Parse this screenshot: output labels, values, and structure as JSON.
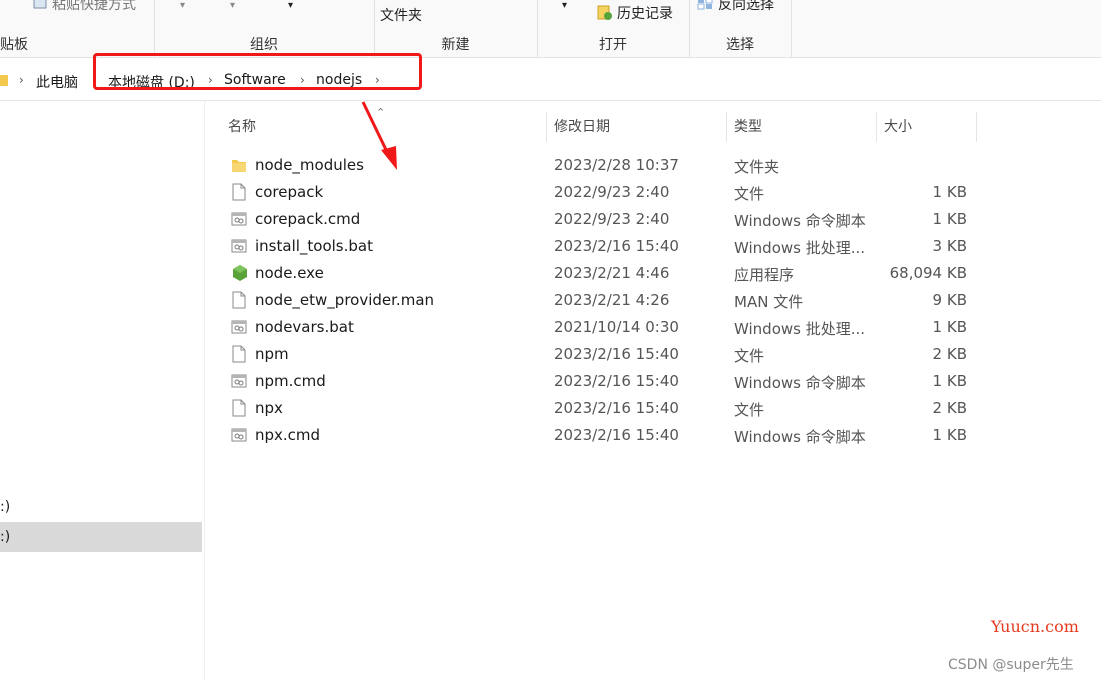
{
  "ribbon": {
    "clipboard_label": "贴板",
    "paste_shortcut": "粘贴快捷方式",
    "organize_label": "组织",
    "new_folder": "文件夹",
    "new_label": "新建",
    "history": "历史记录",
    "open_label": "打开",
    "invert_selection": "反向选择",
    "select_label": "选择"
  },
  "address": {
    "crumbs": [
      "此电脑",
      "本地磁盘 (D:)",
      "Software",
      "nodejs"
    ]
  },
  "nav": {
    "items": [
      {
        "label": ":)",
        "selected": false
      },
      {
        "label": ":)",
        "selected": true
      }
    ]
  },
  "columns": {
    "name": "名称",
    "date": "修改日期",
    "type": "类型",
    "size": "大小"
  },
  "files": [
    {
      "name": "node_modules",
      "date": "2023/2/28 10:37",
      "type": "文件夹",
      "size": "",
      "icon": "folder-icon"
    },
    {
      "name": "corepack",
      "date": "2022/9/23 2:40",
      "type": "文件",
      "size": "1 KB",
      "icon": "file-icon"
    },
    {
      "name": "corepack.cmd",
      "date": "2022/9/23 2:40",
      "type": "Windows 命令脚本",
      "size": "1 KB",
      "icon": "script-icon"
    },
    {
      "name": "install_tools.bat",
      "date": "2023/2/16 15:40",
      "type": "Windows 批处理...",
      "size": "3 KB",
      "icon": "script-icon"
    },
    {
      "name": "node.exe",
      "date": "2023/2/21 4:46",
      "type": "应用程序",
      "size": "68,094 KB",
      "icon": "nodejs-icon"
    },
    {
      "name": "node_etw_provider.man",
      "date": "2023/2/21 4:26",
      "type": "MAN 文件",
      "size": "9 KB",
      "icon": "file-icon"
    },
    {
      "name": "nodevars.bat",
      "date": "2021/10/14 0:30",
      "type": "Windows 批处理...",
      "size": "1 KB",
      "icon": "script-icon"
    },
    {
      "name": "npm",
      "date": "2023/2/16 15:40",
      "type": "文件",
      "size": "2 KB",
      "icon": "file-icon"
    },
    {
      "name": "npm.cmd",
      "date": "2023/2/16 15:40",
      "type": "Windows 命令脚本",
      "size": "1 KB",
      "icon": "script-icon"
    },
    {
      "name": "npx",
      "date": "2023/2/16 15:40",
      "type": "文件",
      "size": "2 KB",
      "icon": "file-icon"
    },
    {
      "name": "npx.cmd",
      "date": "2023/2/16 15:40",
      "type": "Windows 命令脚本",
      "size": "1 KB",
      "icon": "script-icon"
    }
  ],
  "watermarks": {
    "site": "Yuucn.com",
    "author": "CSDN @super先生"
  },
  "colors": {
    "annotation": "#f01818",
    "selected_nav": "#d9d9d9",
    "folder": "#f2c94c",
    "nodejs": "#58a43b"
  }
}
